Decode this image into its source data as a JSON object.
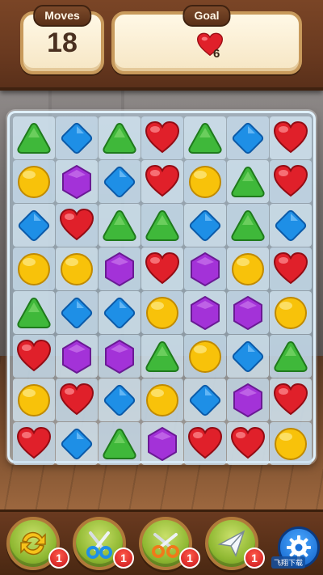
{
  "header": {
    "moves_title": "Moves",
    "moves_value": "18",
    "goal_title": "Goal",
    "goal_icon": "heart",
    "goal_count": "6"
  },
  "board": {
    "rows": [
      [
        "triangle",
        "diamond",
        "triangle",
        "heart",
        "triangle",
        "diamond",
        "heart"
      ],
      [
        "circle",
        "hexagon",
        "diamond",
        "heart",
        "circle",
        "triangle",
        "heart"
      ],
      [
        "diamond",
        "heart",
        "triangle",
        "triangle",
        "diamond",
        "triangle",
        "diamond"
      ],
      [
        "circle",
        "circle",
        "hexagon",
        "heart",
        "hexagon",
        "circle",
        "heart"
      ],
      [
        "triangle",
        "diamond",
        "diamond",
        "circle",
        "hexagon",
        "hexagon",
        "circle"
      ],
      [
        "heart",
        "hexagon",
        "hexagon",
        "triangle",
        "circle",
        "diamond",
        "triangle"
      ],
      [
        "circle",
        "heart",
        "diamond",
        "circle",
        "diamond",
        "hexagon",
        "heart"
      ],
      [
        "heart",
        "diamond",
        "triangle",
        "hexagon",
        "heart",
        "heart",
        "circle"
      ]
    ]
  },
  "boosters": [
    {
      "name": "shuffle-icon",
      "count": "1"
    },
    {
      "name": "scissors-blue-icon",
      "count": "1"
    },
    {
      "name": "scissors-orange-icon",
      "count": "1"
    },
    {
      "name": "paper-plane-icon",
      "count": "1"
    }
  ],
  "settings_icon": "gear-icon",
  "watermark": "飞翔下载",
  "colors": {
    "triangle": "#3fb83a",
    "diamond": "#1e8fe6",
    "heart": "#e0202a",
    "circle": "#f8c20a",
    "hexagon": "#a332d8"
  }
}
